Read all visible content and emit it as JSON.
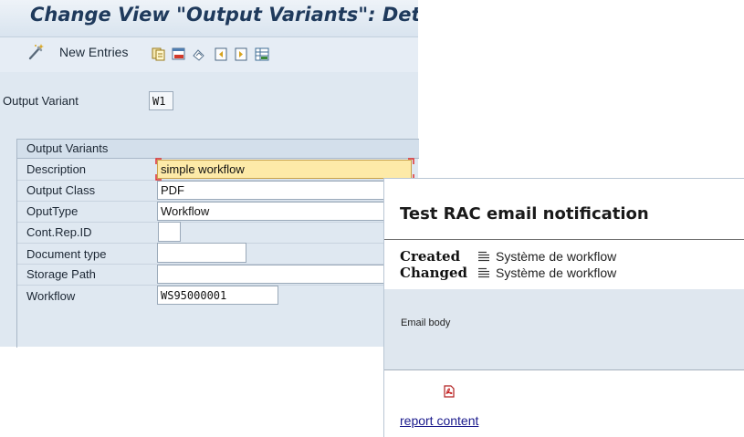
{
  "sap": {
    "title": "Change View \"Output Variants\": Detail",
    "toolbar": {
      "new_entries_label": "New Entries"
    },
    "output_variant": {
      "label": "Output Variant",
      "value": "W1"
    },
    "group": {
      "title": "Output Variants",
      "fields": {
        "description": {
          "label": "Description",
          "value": "simple workflow"
        },
        "output_class": {
          "label": "Output Class",
          "value": "PDF"
        },
        "output_type": {
          "label": "OputType",
          "value": "Workflow"
        },
        "cont_rep_id": {
          "label": "Cont.Rep.ID",
          "value": ""
        },
        "document_type": {
          "label": "Document type",
          "value": ""
        },
        "storage_path": {
          "label": "Storage Path",
          "value": ""
        },
        "workflow": {
          "label": "Workflow",
          "value": "WS95000001"
        }
      }
    }
  },
  "notification": {
    "title": "Test RAC email notification",
    "created_label": "Created",
    "created_value": "Système de workflow",
    "changed_label": "Changed",
    "changed_value": "Système de workflow",
    "body_label": "Email body",
    "attachment_link": "report content"
  },
  "colors": {
    "sap_background": "#dfe8f1",
    "focus_field": "#fdeaa8",
    "focus_marker": "#e03030",
    "link": "#1a1a8c"
  }
}
